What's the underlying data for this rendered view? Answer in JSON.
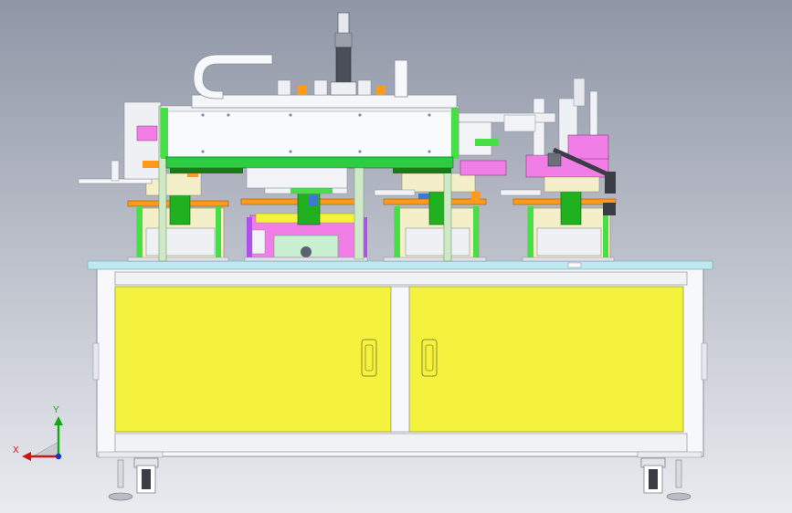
{
  "viewport": {
    "background_top": "#8f96a6",
    "background_bottom": "#e9ebef"
  },
  "axis_triad": {
    "x_label": "X",
    "y_label": "Y",
    "x_color": "#d11414",
    "y_color": "#14a814",
    "z_color": "#1636c8"
  },
  "colors": {
    "cabinet_frame": "#f7f8fb",
    "cabinet_stroke": "#8a8f99",
    "door_panel": "#f5f23d",
    "tabletop": "#bfe8f0",
    "gantry_beam": "#f9fafc",
    "green_frame": "#46e046",
    "pink_part": "#f07ee6",
    "orange_plate": "#ff9a1f",
    "cream_block": "#f4efc8",
    "purple_part": "#b04ff0",
    "dark_part": "#3a3d44"
  }
}
